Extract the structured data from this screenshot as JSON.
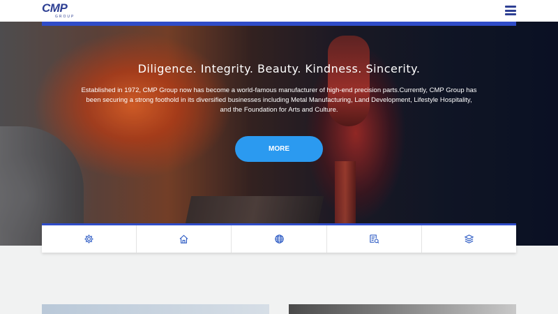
{
  "header": {
    "logo_text": "CMP",
    "logo_sub": "GROUP"
  },
  "hero": {
    "tagline": "Diligence. Integrity. Beauty. Kindness. Sincerity.",
    "intro": "Established in 1972, CMP Group now has become a world-famous manufacturer of high-end precision parts.Currently, CMP Group has been securing a strong foothold in its diversified businesses including Metal Manufacturing, Land Development, Lifestyle Hospitality, and the Foundation for Arts and Culture.",
    "more_label": "MORE"
  },
  "iconbar": {
    "items": [
      {
        "icon": "gear-icon"
      },
      {
        "icon": "home-icon"
      },
      {
        "icon": "globe-icon"
      },
      {
        "icon": "document-search-icon"
      },
      {
        "icon": "layers-icon"
      }
    ]
  },
  "colors": {
    "brand": "#2d3f93",
    "accent_bar": "#2f4cc8",
    "button": "#2b9af0",
    "page_bg": "#f1f2f2"
  }
}
